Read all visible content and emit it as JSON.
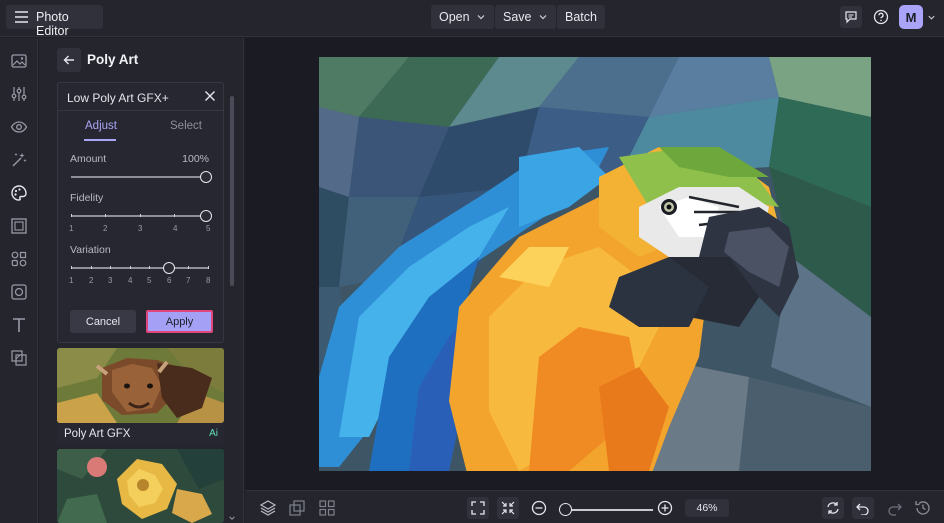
{
  "app": {
    "title": "Photo Editor",
    "menu_icon": "hamburger-icon"
  },
  "toolbar": {
    "open_label": "Open",
    "save_label": "Save",
    "batch_label": "Batch"
  },
  "topright": {
    "feedback_icon": "comment-icon",
    "help_icon": "help-icon",
    "avatar_letter": "M"
  },
  "rail": {
    "icons": [
      "image-icon",
      "sliders-icon",
      "eye-icon",
      "magic-wand-icon",
      "palette-icon",
      "frame-icon",
      "shapes-icon",
      "texture-icon",
      "text-icon",
      "overlay-icon"
    ]
  },
  "panel": {
    "title": "Poly Art",
    "effect": {
      "title": "Low Poly Art GFX+",
      "tabs": [
        "Adjust",
        "Select"
      ],
      "active_tab": "Adjust",
      "sliders": [
        {
          "label": "Amount",
          "value": "100%",
          "fraction": 1.0,
          "ticks": []
        },
        {
          "label": "Fidelity",
          "value": "",
          "fraction": 1.0,
          "ticks": [
            "1",
            "2",
            "3",
            "4",
            "5"
          ]
        },
        {
          "label": "Variation",
          "value": "",
          "fraction": 0.714,
          "ticks": [
            "1",
            "2",
            "3",
            "4",
            "5",
            "6",
            "7",
            "8"
          ]
        }
      ],
      "cancel_label": "Cancel",
      "apply_label": "Apply"
    },
    "presets": [
      {
        "name": "Poly Art GFX",
        "badge": "Ai"
      },
      {
        "name": "",
        "badge": ""
      }
    ]
  },
  "canvas": {
    "zoom": "46%",
    "zoom_fraction": 0.0
  },
  "colors": {
    "accent": "#a9a6f5",
    "highlight_border": "#e0457b",
    "ai_badge": "#5fe0b6",
    "background": "#1e1f27"
  }
}
